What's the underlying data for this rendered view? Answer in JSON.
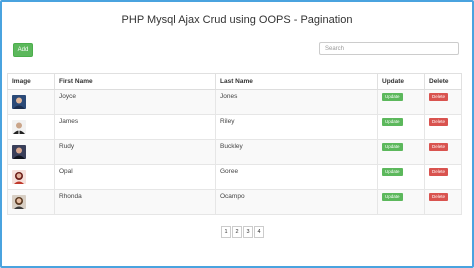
{
  "page": {
    "title": "PHP Mysql Ajax Crud using OOPS - Pagination",
    "add_label": "Add",
    "search_placeholder": "Search"
  },
  "table": {
    "headers": [
      "Image",
      "First Name",
      "Last Name",
      "Update",
      "Delete"
    ],
    "rows": [
      {
        "first": "Joyce",
        "last": "Jones",
        "update": "Update",
        "delete": "Delete"
      },
      {
        "first": "James",
        "last": "Riley",
        "update": "Update",
        "delete": "Delete"
      },
      {
        "first": "Rudy",
        "last": "Buckley",
        "update": "Update",
        "delete": "Delete"
      },
      {
        "first": "Opal",
        "last": "Goree",
        "update": "Update",
        "delete": "Delete"
      },
      {
        "first": "Rhonda",
        "last": "Ocampo",
        "update": "Update",
        "delete": "Delete"
      }
    ]
  },
  "pagination": [
    "1",
    "2",
    "3",
    "4"
  ],
  "colors": {
    "success": "#5cb85c",
    "danger": "#d9534f",
    "frame": "#4aa3df"
  }
}
